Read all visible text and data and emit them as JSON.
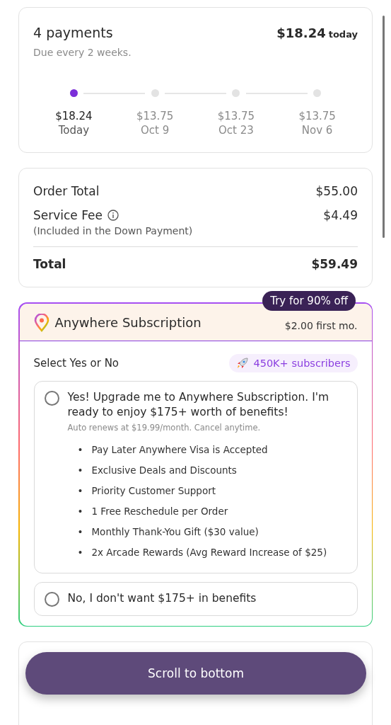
{
  "plan": {
    "title": "4 payments",
    "amount": "$18.24",
    "amount_suffix": "today",
    "subtitle": "Due every 2 weeks.",
    "payments": [
      {
        "amount": "$18.24",
        "date": "Today",
        "selected": true
      },
      {
        "amount": "$13.75",
        "date": "Oct 9",
        "selected": false
      },
      {
        "amount": "$13.75",
        "date": "Oct 23",
        "selected": false
      },
      {
        "amount": "$13.75",
        "date": "Nov 6",
        "selected": false
      }
    ]
  },
  "summary": {
    "lines": [
      {
        "label": "Order Total",
        "value": "$55.00",
        "info": false
      },
      {
        "label": "Service Fee",
        "note": "(Included in the Down Payment)",
        "value": "$4.49",
        "info": true
      }
    ],
    "total": {
      "label": "Total",
      "value": "$59.49"
    }
  },
  "subscription": {
    "badge": "Try for 90% off",
    "title": "Anywhere Subscription",
    "price": "$2.00 first mo.",
    "prompt": "Select Yes or No",
    "subscribers": "450K+ subscribers",
    "options": [
      {
        "label": "Yes! Upgrade me to Anywhere Subscription. I'm ready to enjoy $175+ worth of benefits!",
        "note": "Auto renews at $19.99/month. Cancel anytime.",
        "selected": false,
        "benefits": [
          {
            "bullet": "•",
            "text": "Pay Later Anywhere Visa is Accepted"
          },
          {
            "bullet": "•",
            "text": "Exclusive Deals and Discounts"
          },
          {
            "bullet": "•",
            "text": "Priority Customer Support"
          },
          {
            "bullet": "•",
            "text": "1 Free Reschedule per Order"
          },
          {
            "bullet": "•",
            "text": "Monthly Thank-You Gift ($30 value)"
          },
          {
            "bullet": "•",
            "text": "2x Arcade Rewards (Avg Reward Increase of $25)"
          }
        ]
      },
      {
        "label": "No, I don't want $175+ in benefits",
        "selected": false
      }
    ]
  },
  "scroll_button": "Scroll to bottom"
}
